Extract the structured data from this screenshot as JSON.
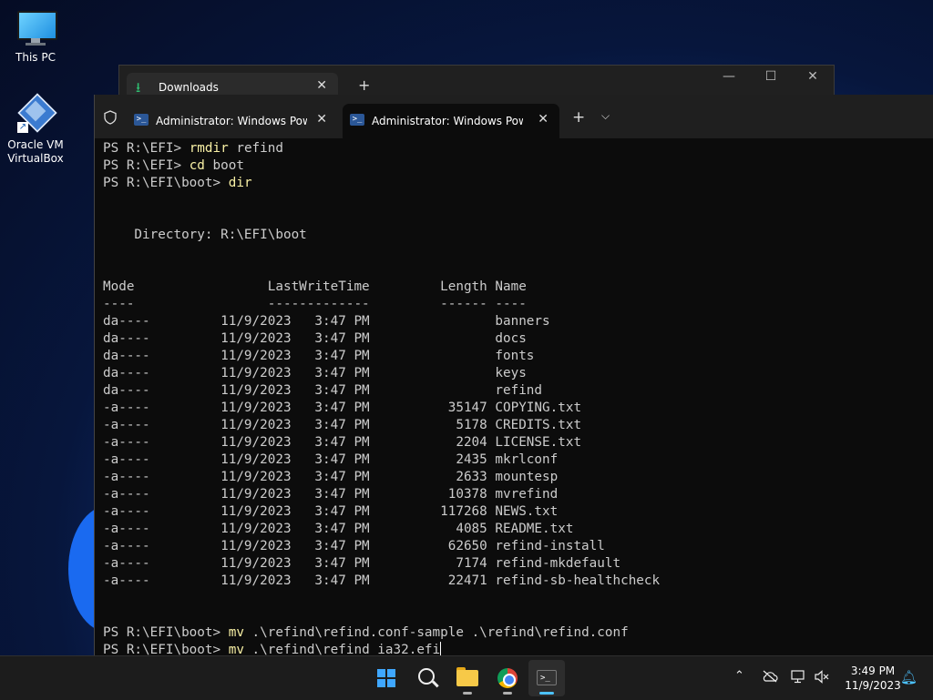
{
  "desktop": {
    "icons": [
      {
        "label": "This PC"
      },
      {
        "label_line1": "Oracle VM",
        "label_line2": "VirtualBox"
      }
    ]
  },
  "back_window": {
    "tab_title": "Downloads",
    "close_glyph": "✕",
    "new_tab_glyph": "+",
    "minimize_glyph": "—",
    "maximize_glyph": "☐",
    "close_window_glyph": "✕"
  },
  "terminal": {
    "tabs": [
      {
        "title": "Administrator: Windows PowerShell",
        "active": false
      },
      {
        "title": "Administrator: Windows PowerShell",
        "active": true
      }
    ],
    "new_tab_glyph": "+",
    "dropdown_glyph": "⌵",
    "lines": [
      {
        "prompt": "PS R:\\EFI> ",
        "cmd": "rmdir",
        "rest": " refind"
      },
      {
        "prompt": "PS R:\\EFI> ",
        "cmd": "cd",
        "rest": " boot"
      },
      {
        "prompt": "PS R:\\EFI\\boot> ",
        "cmd": "dir",
        "rest": ""
      },
      {
        "text": ""
      },
      {
        "text": ""
      },
      {
        "text": "    Directory: R:\\EFI\\boot"
      },
      {
        "text": ""
      },
      {
        "text": ""
      },
      {
        "text": "Mode                 LastWriteTime         Length Name"
      },
      {
        "text": "----                 -------------         ------ ----"
      },
      {
        "text": "da----         11/9/2023   3:47 PM                banners"
      },
      {
        "text": "da----         11/9/2023   3:47 PM                docs"
      },
      {
        "text": "da----         11/9/2023   3:47 PM                fonts"
      },
      {
        "text": "da----         11/9/2023   3:47 PM                keys"
      },
      {
        "text": "da----         11/9/2023   3:47 PM                refind"
      },
      {
        "text": "-a----         11/9/2023   3:47 PM          35147 COPYING.txt"
      },
      {
        "text": "-a----         11/9/2023   3:47 PM           5178 CREDITS.txt"
      },
      {
        "text": "-a----         11/9/2023   3:47 PM           2204 LICENSE.txt"
      },
      {
        "text": "-a----         11/9/2023   3:47 PM           2435 mkrlconf"
      },
      {
        "text": "-a----         11/9/2023   3:47 PM           2633 mountesp"
      },
      {
        "text": "-a----         11/9/2023   3:47 PM          10378 mvrefind"
      },
      {
        "text": "-a----         11/9/2023   3:47 PM         117268 NEWS.txt"
      },
      {
        "text": "-a----         11/9/2023   3:47 PM           4085 README.txt"
      },
      {
        "text": "-a----         11/9/2023   3:47 PM          62650 refind-install"
      },
      {
        "text": "-a----         11/9/2023   3:47 PM           7174 refind-mkdefault"
      },
      {
        "text": "-a----         11/9/2023   3:47 PM          22471 refind-sb-healthcheck"
      },
      {
        "text": ""
      },
      {
        "text": ""
      },
      {
        "prompt": "PS R:\\EFI\\boot> ",
        "cmd": "mv",
        "rest": " .\\refind\\refind.conf-sample .\\refind\\refind.conf"
      },
      {
        "prompt": "PS R:\\EFI\\boot> ",
        "cmd": "mv",
        "rest": " .\\refind\\refind_ia32.efi",
        "cursor": true
      }
    ]
  },
  "taskbar": {
    "items": [
      {
        "name": "start-button",
        "active": false
      },
      {
        "name": "search-button",
        "active": false
      },
      {
        "name": "file-explorer-button",
        "active": false,
        "running": true
      },
      {
        "name": "chrome-button",
        "active": false,
        "running": true
      },
      {
        "name": "terminal-button",
        "active": true,
        "running": true
      }
    ],
    "tray": {
      "chevron_glyph": "⌃",
      "time": "3:49 PM",
      "date": "11/9/2023"
    },
    "accent_color": "#4cc2ff"
  }
}
